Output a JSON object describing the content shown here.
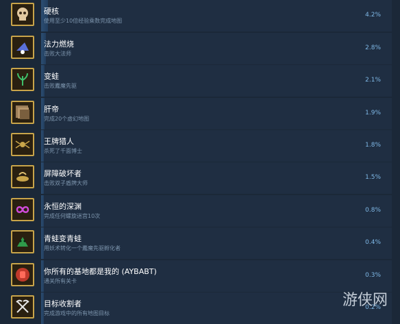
{
  "achievements": [
    {
      "title": "硬核",
      "desc": "使用至少10倍经验乘数完成地图",
      "percent": "4.2%",
      "fill": 0.042,
      "icon": "skull-icon"
    },
    {
      "title": "法力燃烧",
      "desc": "击败大法师",
      "percent": "2.8%",
      "fill": 0.028,
      "icon": "wizard-hat-icon"
    },
    {
      "title": "变蛙",
      "desc": "击败蠹魔先驱",
      "percent": "2.1%",
      "fill": 0.021,
      "icon": "plant-icon"
    },
    {
      "title": "肝帝",
      "desc": "完成20个虚幻地图",
      "percent": "1.9%",
      "fill": 0.019,
      "icon": "map-stack-icon"
    },
    {
      "title": "王牌猎人",
      "desc": "杀死了千面博士",
      "percent": "1.8%",
      "fill": 0.018,
      "icon": "spider-icon"
    },
    {
      "title": "屏障破坏者",
      "desc": "击败双子盾牌大师",
      "percent": "1.5%",
      "fill": 0.015,
      "icon": "broken-shield-icon"
    },
    {
      "title": "永恒的深渊",
      "desc": "完成任何螺旋迷宫10次",
      "percent": "0.8%",
      "fill": 0.008,
      "icon": "infinity-icon"
    },
    {
      "title": "青蛙变青蛙",
      "desc": "用妖术转化一个蠹魔先驱孵化者",
      "percent": "0.4%",
      "fill": 0.004,
      "icon": "frog-icon"
    },
    {
      "title": "你所有的基地都是我的 (AYBABT)",
      "desc": "通关所有关卡",
      "percent": "0.3%",
      "fill": 0.003,
      "icon": "red-fist-icon"
    },
    {
      "title": "目标收割者",
      "desc": "完成游戏中的所有地图目标",
      "percent": "0.2%",
      "fill": 0.002,
      "icon": "crossed-scythes-icon"
    }
  ],
  "watermark": "游侠网",
  "colors": {
    "accent": "#7fb8e6",
    "border": "#c9a54a",
    "background": "#1b2838"
  }
}
